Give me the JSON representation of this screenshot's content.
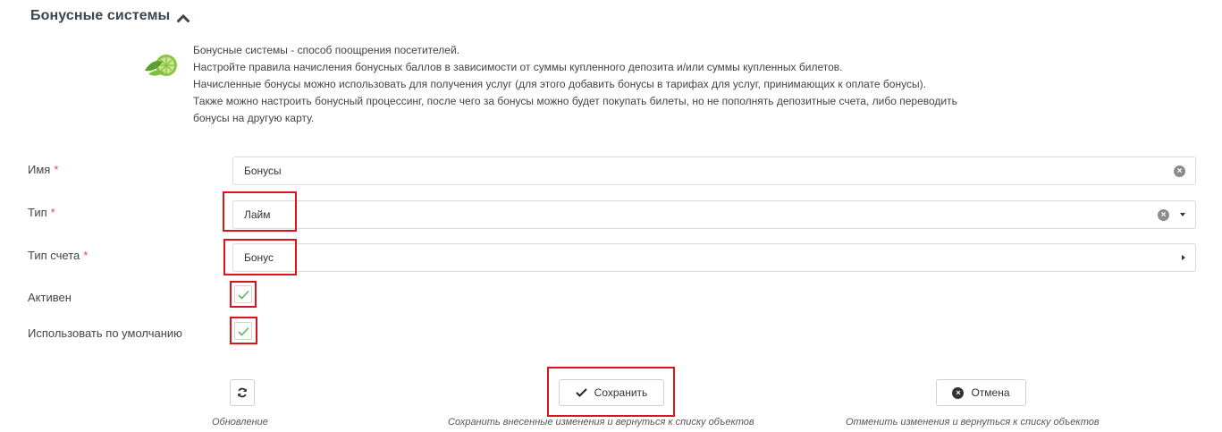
{
  "section": {
    "title": "Бонусные системы",
    "collapse_icon": "chevron-up-icon"
  },
  "info": {
    "icon": "lime-icon",
    "lines": [
      "Бонусные системы - способ поощрения посетителей.",
      "Настройте правила начисления бонусных баллов в зависимости от суммы купленного депозита и/или суммы купленных билетов.",
      "Начисленные бонусы можно использовать для получения услуг (для этого добавить бонусы в тарифах для услуг, принимающих к оплате бонусы).",
      "Также можно настроить бонусный процессинг, после чего за бонусы можно будет покупать билеты, но не пополнять депозитные счета, либо переводить",
      "бонусы на другую карту."
    ]
  },
  "form": {
    "name": {
      "label": "Имя",
      "required_mark": "*",
      "value": "Бонусы"
    },
    "type": {
      "label": "Тип",
      "required_mark": "*",
      "value": "Лайм"
    },
    "account_type": {
      "label": "Тип счета",
      "required_mark": "*",
      "value": "Бонус"
    },
    "active": {
      "label": "Активен",
      "checked": true
    },
    "default": {
      "label": "Использовать по умолчанию",
      "checked": true
    }
  },
  "actions": {
    "refresh": {
      "icon": "refresh-icon",
      "caption": "Обновление"
    },
    "save": {
      "label": "Сохранить",
      "icon": "check-icon",
      "caption": "Сохранить внесенные изменения и вернуться к списку объектов"
    },
    "cancel": {
      "label": "Отмена",
      "icon": "x-circle-icon",
      "caption": "Отменить изменения и вернуться к списку объектов"
    }
  },
  "colors": {
    "highlight": "#d9141c",
    "required": "#e04a4a",
    "check": "#5cb85c",
    "lime": "#8cc63f"
  }
}
